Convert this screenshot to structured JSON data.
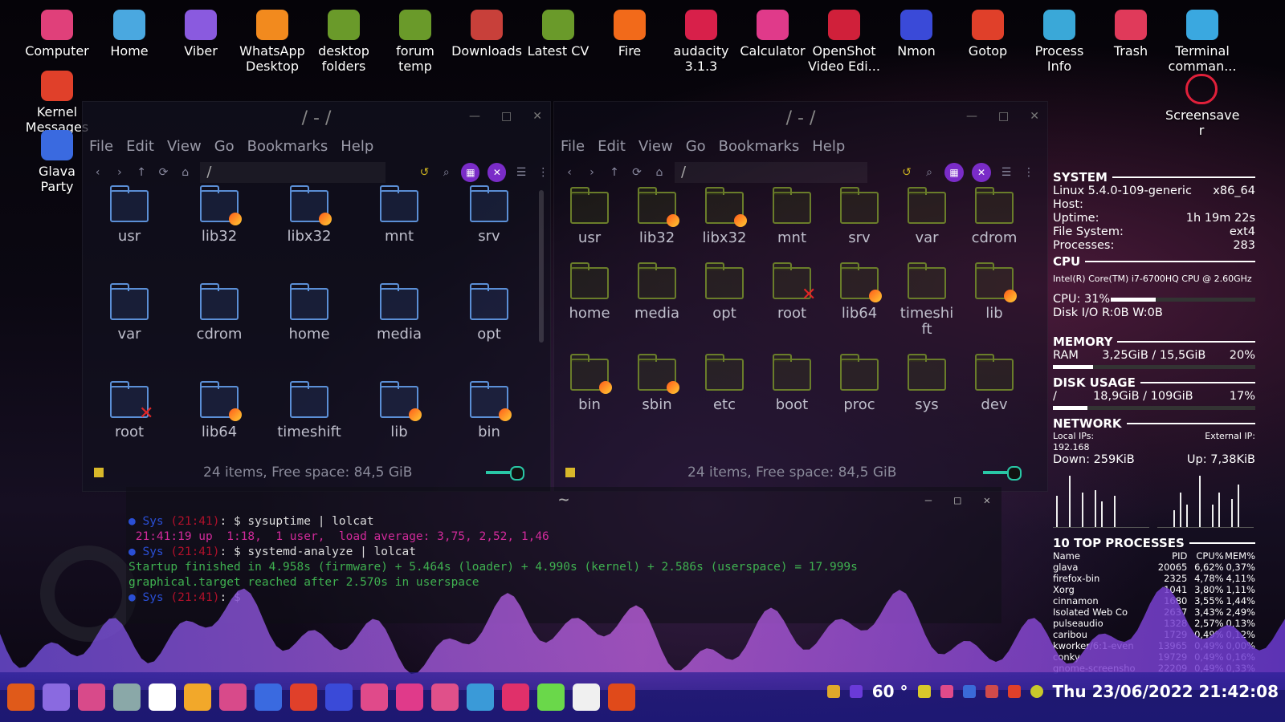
{
  "desktop_icons": [
    {
      "label": "Computer",
      "color": "#e0407a"
    },
    {
      "label": "Home",
      "color": "#4aa8e0"
    },
    {
      "label": "Viber",
      "color": "#8a5adf"
    },
    {
      "label": "WhatsApp\nDesktop",
      "color": "#f28a1e"
    },
    {
      "label": "desktop\nfolders",
      "color": "#6a9a2a"
    },
    {
      "label": "forum\ntemp",
      "color": "#6a9a2a"
    },
    {
      "label": "Downloads",
      "color": "#c8403a"
    },
    {
      "label": "Latest CV",
      "color": "#6a9a2a"
    },
    {
      "label": "Fire",
      "color": "#f26a1a"
    },
    {
      "label": "audacity\n3.1.3",
      "color": "#d8204a"
    },
    {
      "label": "Calculator",
      "color": "#e03a8a"
    },
    {
      "label": "OpenShot\nVideo Edi...",
      "color": "#d0203a"
    },
    {
      "label": "Nmon",
      "color": "#3a4ad8"
    },
    {
      "label": "Gotop",
      "color": "#e0402a"
    },
    {
      "label": "Process\nInfo",
      "color": "#3aa8d8"
    },
    {
      "label": "Trash",
      "color": "#e03a5a"
    },
    {
      "label": "Terminal\ncomman...",
      "color": "#3aa8e0"
    }
  ],
  "left_icons": [
    {
      "label": "Kernel\nMessages",
      "color": "#e0402a"
    },
    {
      "label": "Glava Party",
      "color": "#3a6ae0"
    }
  ],
  "screensaver_icon": {
    "label": "Screensave\nr",
    "color": "#e0203a"
  },
  "fm_left": {
    "title": "/ - /",
    "menu": [
      "File",
      "Edit",
      "View",
      "Go",
      "Bookmarks",
      "Help"
    ],
    "path": "/",
    "files": [
      {
        "name": "usr",
        "badge": ""
      },
      {
        "name": "lib32",
        "badge": "link"
      },
      {
        "name": "libx32",
        "badge": "link"
      },
      {
        "name": "mnt",
        "badge": ""
      },
      {
        "name": "srv",
        "badge": ""
      },
      {
        "name": "var",
        "badge": ""
      },
      {
        "name": "cdrom",
        "badge": ""
      },
      {
        "name": "home",
        "badge": ""
      },
      {
        "name": "media",
        "badge": ""
      },
      {
        "name": "opt",
        "badge": ""
      },
      {
        "name": "root",
        "badge": "x"
      },
      {
        "name": "lib64",
        "badge": "link"
      },
      {
        "name": "timeshift",
        "badge": ""
      },
      {
        "name": "lib",
        "badge": "link"
      },
      {
        "name": "bin",
        "badge": "link"
      }
    ],
    "status": "24 items, Free space: 84,5 GiB"
  },
  "fm_right": {
    "title": "/ - /",
    "menu": [
      "File",
      "Edit",
      "View",
      "Go",
      "Bookmarks",
      "Help"
    ],
    "path": "/",
    "files": [
      {
        "name": "usr",
        "badge": ""
      },
      {
        "name": "lib32",
        "badge": "link"
      },
      {
        "name": "libx32",
        "badge": "link"
      },
      {
        "name": "mnt",
        "badge": ""
      },
      {
        "name": "srv",
        "badge": ""
      },
      {
        "name": "var",
        "badge": ""
      },
      {
        "name": "cdrom",
        "badge": ""
      },
      {
        "name": "home",
        "badge": ""
      },
      {
        "name": "media",
        "badge": ""
      },
      {
        "name": "opt",
        "badge": ""
      },
      {
        "name": "root",
        "badge": "x"
      },
      {
        "name": "lib64",
        "badge": "link"
      },
      {
        "name": "timeshi\nft",
        "badge": ""
      },
      {
        "name": "lib",
        "badge": "link"
      },
      {
        "name": "bin",
        "badge": "link"
      },
      {
        "name": "sbin",
        "badge": "link"
      },
      {
        "name": "etc",
        "badge": ""
      },
      {
        "name": "boot",
        "badge": ""
      },
      {
        "name": "proc",
        "badge": ""
      },
      {
        "name": "sys",
        "badge": ""
      },
      {
        "name": "dev",
        "badge": ""
      }
    ],
    "status": "24 items, Free space: 84,5 GiB"
  },
  "terminal": {
    "title": "~",
    "line1_prompt": "● Sys",
    "line1_time": "(21:41)",
    "line1_cmd": ": $ sysuptime | lolcat",
    "line2": " 21:41:19 up  1:18,  1 user,  load average: 3,75, 2,52, 1,46",
    "line3_prompt": "● Sys",
    "line3_time": "(21:41)",
    "line3_cmd": ": $ systemd-analyze | lolcat",
    "line4": "Startup finished in 4.958s (firmware) + 5.464s (loader) + 4.990s (kernel) + 2.586s (userspace) = 17.999s",
    "line5": "graphical.target reached after 2.570s in userspace",
    "line6_prompt": "● Sys",
    "line6_time": "(21:41)",
    "line6_cmd": ": $"
  },
  "conky": {
    "system_head": "SYSTEM",
    "kernel": "Linux 5.4.0-109-generic",
    "arch": "x86_64",
    "host_label": "Host:",
    "uptime_label": "Uptime:",
    "uptime": "1h 19m 22s",
    "fs_label": "File System:",
    "fs": "ext4",
    "proc_label": "Processes:",
    "procs": "283",
    "cpu_head": "CPU",
    "cpu_model": "Intel(R) Core(TM) i7-6700HQ CPU @ 2.60GHz",
    "cpu_usage": "CPU: 31%",
    "cpu_fraction": 0.31,
    "disk_io": "Disk I/O R:0B   W:0B",
    "memory_head": "MEMORY",
    "ram_label": "RAM",
    "ram": "3,25GiB / 15,5GiB",
    "ram_pct": "20%",
    "ram_fraction": 0.2,
    "disk_head": "DISK USAGE",
    "disk_mount": "/",
    "disk": "18,9GiB / 109GiB",
    "disk_pct": "17%",
    "disk_fraction": 0.17,
    "network_head": "NETWORK",
    "local_ips_label": "Local IPs:",
    "external_ip_label": "External IP:",
    "local_ip": "192.168",
    "down": "Down: 259KiB",
    "up": "Up: 7,38KiB",
    "top_head": "10 TOP PROCESSES",
    "proc_cols": [
      "Name",
      "PID",
      "CPU%",
      "MEM%"
    ],
    "processes": [
      [
        "glava",
        "20065",
        "6,62%",
        "0,37%"
      ],
      [
        "firefox-bin",
        "2325",
        "4,78%",
        "4,11%"
      ],
      [
        "Xorg",
        "1041",
        "3,80%",
        "1,11%"
      ],
      [
        "cinnamon",
        "1680",
        "3,55%",
        "1,44%"
      ],
      [
        "Isolated Web Co",
        "2637",
        "3,43%",
        "2,49%"
      ],
      [
        "pulseaudio",
        "1328",
        "2,57%",
        "0,13%"
      ],
      [
        "caribou",
        "1729",
        "0,49%",
        "0,12%"
      ],
      [
        "kworker/6:1-even",
        "13965",
        "0,49%",
        "0,00%"
      ],
      [
        "conky",
        "19729",
        "0,49%",
        "0,16%"
      ],
      [
        "gnome-screensho",
        "22209",
        "0,49%",
        "0,33%"
      ]
    ]
  },
  "taskbar": {
    "apps": [
      "#e05a1a",
      "#8a6ae0",
      "#d84a8a",
      "#8aa8a8",
      "#ffffff",
      "#f2a82a",
      "#d84a8a",
      "#3a6ae0",
      "#e0402a",
      "#3a4ad8",
      "#e04a8a",
      "#e03a8a",
      "#e0508a",
      "#3a9ad8",
      "#e0306a",
      "#6ad84a",
      "#f0f0f0",
      "#e04a1a"
    ],
    "temp": "60 °",
    "clock": "Thu 23/06/2022 21:42:08"
  }
}
